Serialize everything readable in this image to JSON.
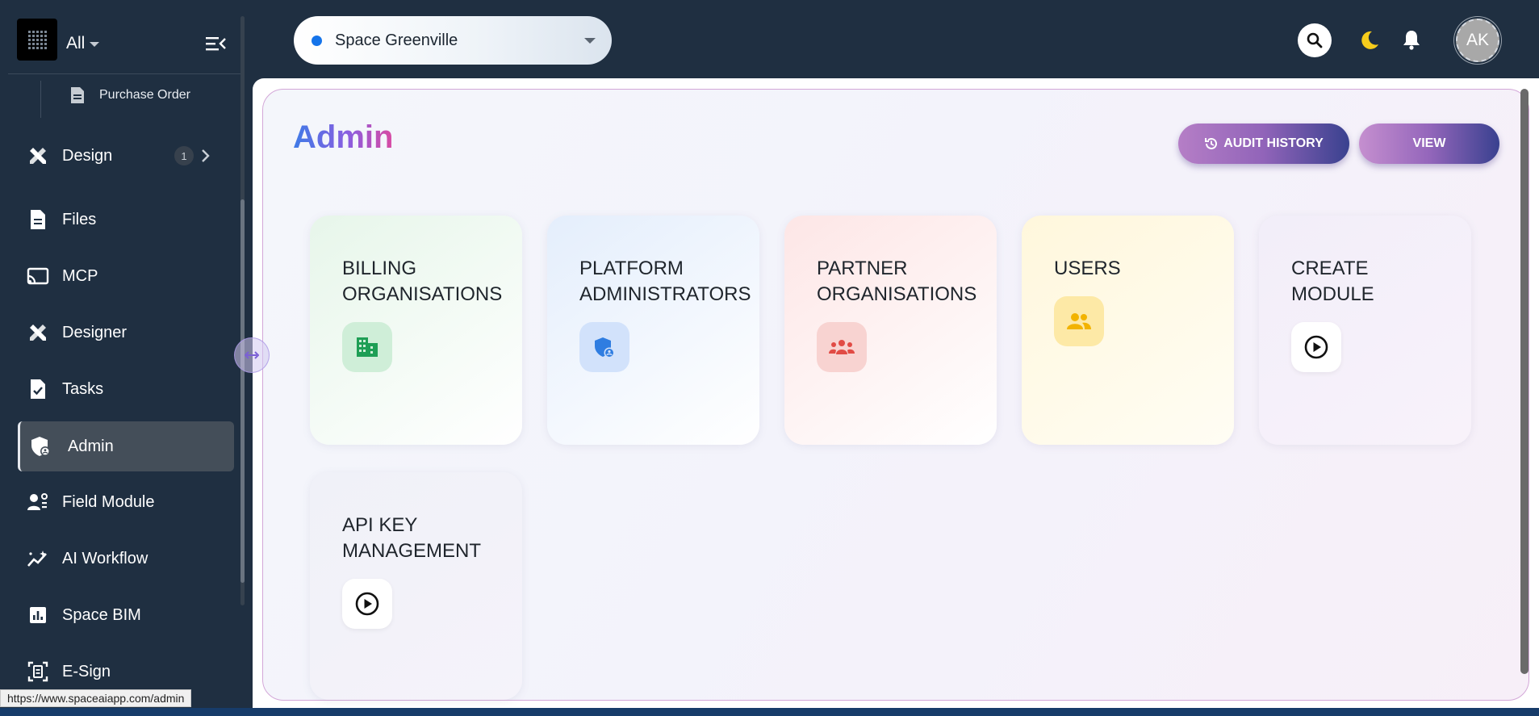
{
  "header": {
    "workspace": "All",
    "space": "Space Greenville",
    "avatar_initials": "AK",
    "colors": {
      "space_dot": "#1574ea",
      "theme_icon": "#f6cc1c"
    }
  },
  "sidebar": {
    "sub_item": {
      "label": "Purchase Order",
      "icon": "document-icon"
    },
    "items": [
      {
        "label": "Design",
        "icon": "design-tools-icon",
        "badge": "1"
      },
      {
        "label": "Files",
        "icon": "file-icon"
      },
      {
        "label": "MCP",
        "icon": "cast-icon"
      },
      {
        "label": "Designer",
        "icon": "design-tools-icon"
      },
      {
        "label": "Tasks",
        "icon": "task-icon"
      },
      {
        "label": "Admin",
        "icon": "admin-shield-icon",
        "active": true
      },
      {
        "label": "Field Module",
        "icon": "field-users-icon"
      },
      {
        "label": "AI Workflow",
        "icon": "workflow-icon"
      },
      {
        "label": "Space BIM",
        "icon": "bar-chart-icon"
      },
      {
        "label": "E-Sign",
        "icon": "esign-icon"
      }
    ]
  },
  "main": {
    "title": "Admin",
    "audit_history_label": "AUDIT HISTORY",
    "view_label": "VIEW",
    "cards": [
      {
        "line1": "BILLING",
        "line2": "ORGANISATIONS",
        "icon": "building-icon",
        "icon_color": "#1e9e55"
      },
      {
        "line1": "PLATFORM",
        "line2": "ADMINISTRATORS",
        "icon": "admin-shield-icon",
        "icon_color": "#2f7de1"
      },
      {
        "line1": "PARTNER",
        "line2": "ORGANISATIONS",
        "icon": "group-icon",
        "icon_color": "#e14b45"
      },
      {
        "line1": "USERS",
        "line2": "",
        "icon": "users-icon",
        "icon_color": "#f2b300"
      },
      {
        "line1": "CREATE",
        "line2": "MODULE",
        "icon": "play-circle-icon",
        "icon_color": "#111111"
      },
      {
        "line1": "API KEY",
        "line2": "MANAGEMENT",
        "icon": "play-circle-icon",
        "icon_color": "#111111"
      }
    ]
  },
  "status_url": "https://www.spaceaiapp.com/admin"
}
